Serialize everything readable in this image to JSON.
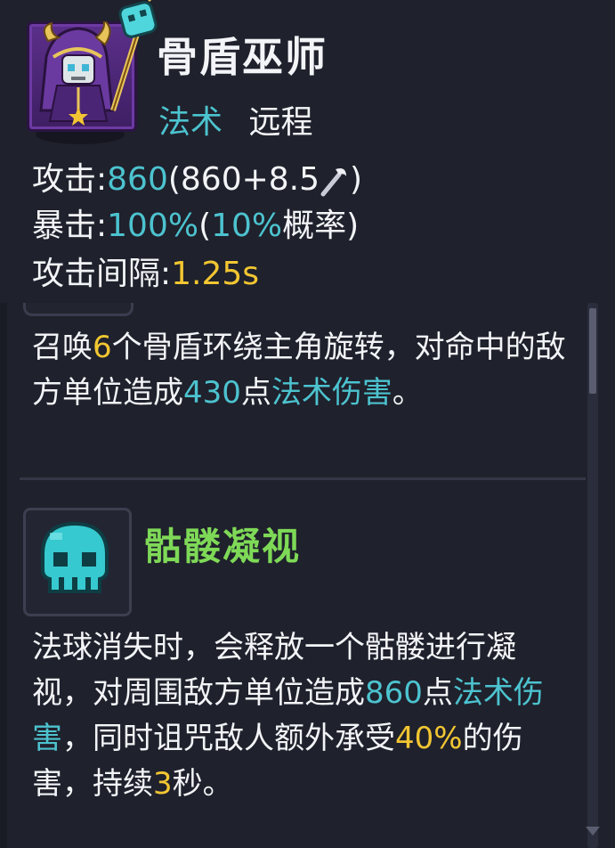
{
  "hero": {
    "name": "骨盾巫师",
    "tags": [
      "法术",
      "远程"
    ],
    "portrait_icon": "skeleton-mage-portrait"
  },
  "stats": {
    "attack": {
      "label": "攻击:",
      "value": "860",
      "detail_open": "(860+8.5",
      "detail_icon": "wand-icon",
      "detail_close": ")"
    },
    "crit": {
      "label": "暴击:",
      "value": "100%",
      "detail_open": "(",
      "chance": "10%",
      "chance_suffix": "概率)"
    },
    "interval": {
      "label": "攻击间隔:",
      "value": "1.25s"
    }
  },
  "skills": [
    {
      "description": {
        "p1": "召唤",
        "count": "6",
        "p2": "个骨盾环绕主角旋转，对命中的敌方单位造成",
        "damage": "430",
        "p3": "点",
        "damage_type": "法术伤害",
        "p4": "。"
      }
    },
    {
      "name": "骷髅凝视",
      "icon": "skull-icon",
      "description": {
        "p1": "法球消失时，会释放一个骷髅进行凝视，对周围敌方单位造成",
        "damage": "860",
        "p2": "点",
        "damage_type": "法术伤害",
        "p3": "，同时诅咒敌人额外承受",
        "percent": "40%",
        "p4": "的伤害，持续",
        "duration": "3",
        "p5": "秒。"
      }
    }
  ],
  "colors": {
    "background": "#1f212c",
    "text": "#f3f4f7",
    "magic_blue": "#4cc3cf",
    "highlight_yellow": "#f2c632",
    "skill_green": "#7ed957",
    "portrait_purple": "#5b2f8a"
  }
}
